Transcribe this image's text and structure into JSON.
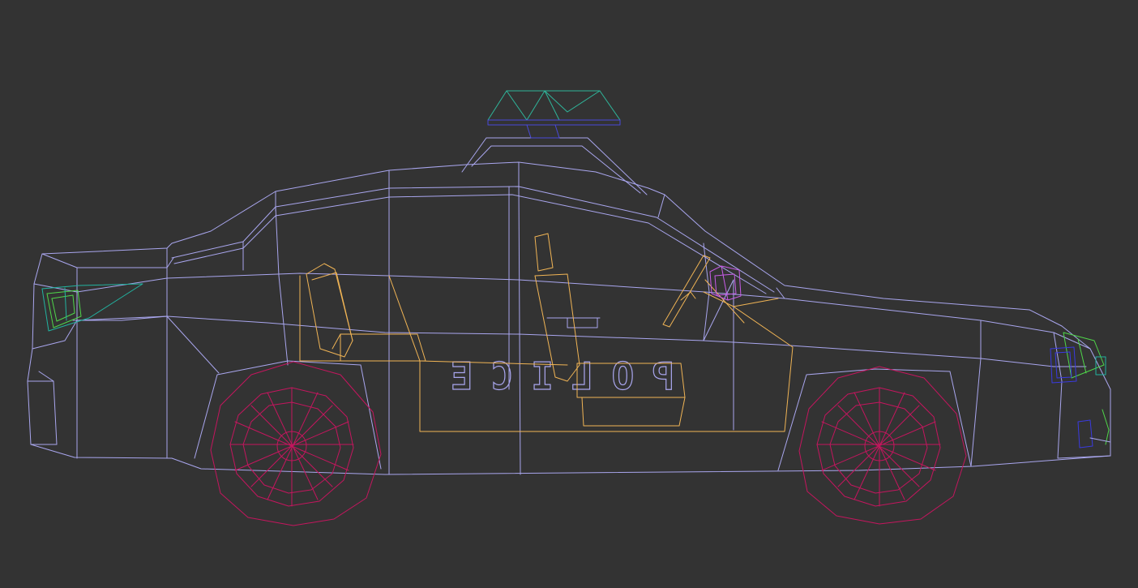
{
  "viewport": {
    "background": "#333333",
    "display_mode": "wireframe",
    "view": "side"
  },
  "model": {
    "decal_text": "POLICE",
    "decal_mirrored": true,
    "colors": {
      "body": "#a9a6ee",
      "interior": "#f0b455",
      "wheel": "#c4165e",
      "lightbar": "#2fb59a",
      "lightbase": "#4a4ad8",
      "mirror": "#c85ce8",
      "lamp_green": "#4fd64a",
      "lamp_teal": "#22b3a0",
      "lamp_blue": "#3a3ae0"
    }
  }
}
